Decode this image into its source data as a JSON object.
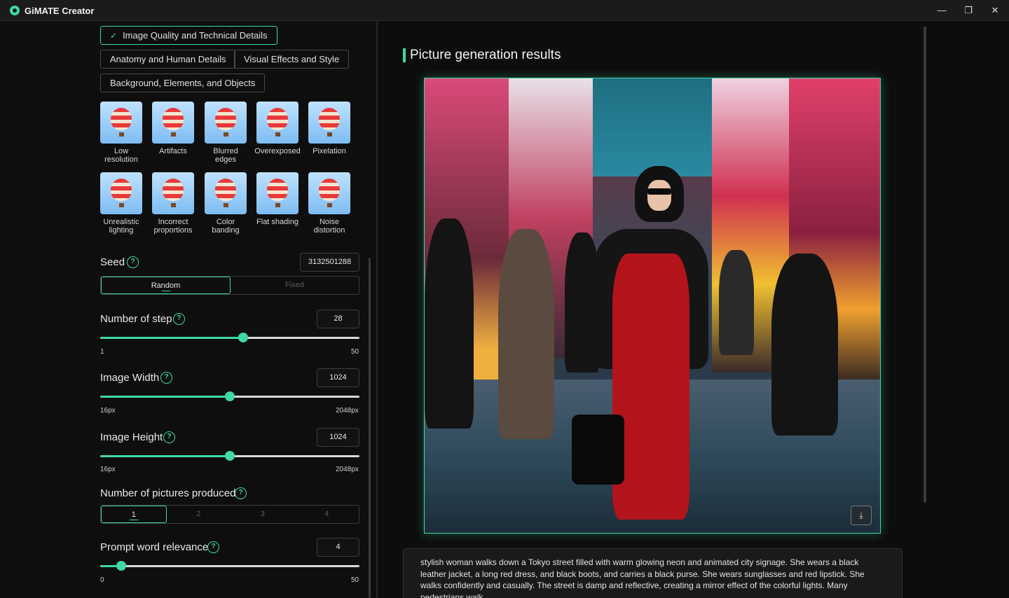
{
  "app": {
    "title": "GiMATE Creator"
  },
  "window_controls": {
    "minimize": "—",
    "maximize": "❐",
    "close": "✕"
  },
  "negative_prompt": {
    "categories": [
      {
        "label": "Image Quality and Technical Details",
        "active": true
      },
      {
        "label": "Anatomy and Human Details",
        "active": false
      },
      {
        "label": "Visual Effects and Style",
        "active": false
      },
      {
        "label": "Background, Elements, and Objects",
        "active": false
      }
    ],
    "items": [
      {
        "line1": "Low",
        "line2": "resolution"
      },
      {
        "line1": "Artifacts",
        "line2": ""
      },
      {
        "line1": "Blurred",
        "line2": "edges"
      },
      {
        "line1": "Overexposed",
        "line2": ""
      },
      {
        "line1": "Pixelation",
        "line2": ""
      },
      {
        "line1": "Unrealistic",
        "line2": "lighting"
      },
      {
        "line1": "Incorrect",
        "line2": "proportions"
      },
      {
        "line1": "Color",
        "line2": "banding"
      },
      {
        "line1": "Flat shading",
        "line2": ""
      },
      {
        "line1": "Noise",
        "line2": "distortion"
      }
    ]
  },
  "seed": {
    "label": "Seed",
    "value": "3132501288",
    "modes": [
      "Random",
      "Fixed"
    ],
    "selected": "Random"
  },
  "steps": {
    "label": "Number of step",
    "value": "28",
    "min": "1",
    "max": "50",
    "fraction": 0.55
  },
  "width": {
    "label": "Image Width",
    "value": "1024",
    "min": "16px",
    "max": "2048px",
    "fraction": 0.5
  },
  "height": {
    "label": "Image Height",
    "value": "1024",
    "min": "16px",
    "max": "2048px",
    "fraction": 0.5
  },
  "pictures": {
    "label": "Number of pictures produced",
    "options": [
      "1",
      "2",
      "3",
      "4"
    ],
    "selected": "1"
  },
  "relevance": {
    "label": "Prompt word relevance",
    "value": "4",
    "min": "0",
    "max": "50",
    "fraction": 0.08
  },
  "result": {
    "title": "Picture generation results",
    "download_icon": "download-icon",
    "prompt": "stylish woman walks down a Tokyo street filled with warm glowing neon and animated city signage. She wears a black leather jacket, a long red dress, and black boots, and carries a black purse. She wears sunglasses and red lipstick. She walks confidently and casually. The street is damp and reflective, creating a mirror effect of the colorful lights. Many pedestrians walk"
  },
  "colors": {
    "accent": "#3fd8a6",
    "background": "#0d0d0d"
  }
}
